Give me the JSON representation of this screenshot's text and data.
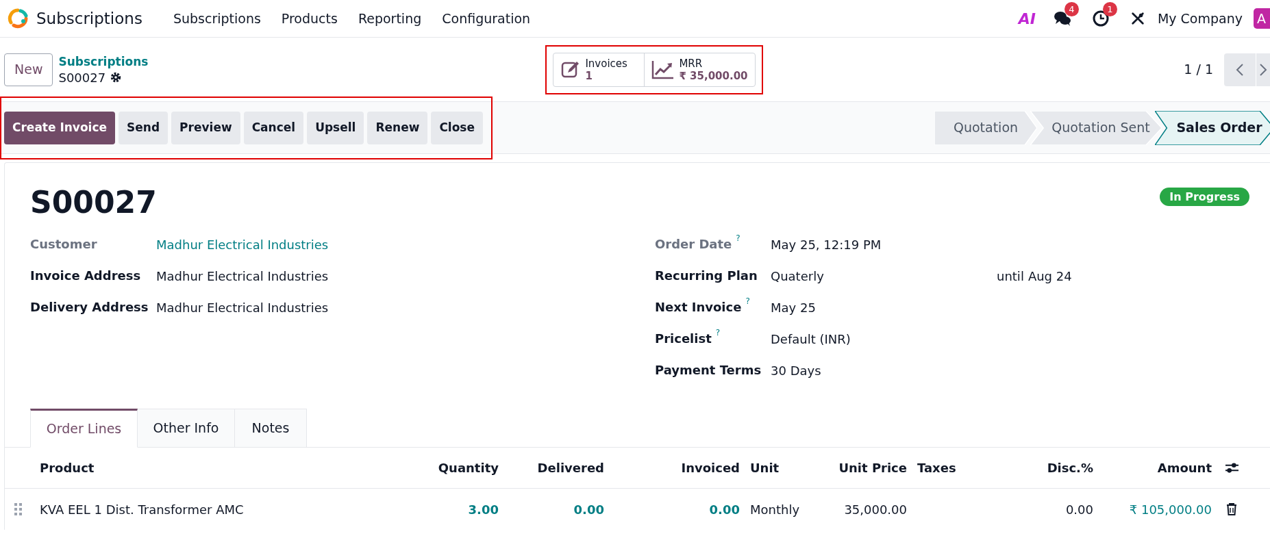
{
  "navbar": {
    "app_name": "Subscriptions",
    "menu": [
      "Subscriptions",
      "Products",
      "Reporting",
      "Configuration"
    ],
    "ai_label": "AI",
    "messages_count": "4",
    "activities_count": "1",
    "company": "My Company",
    "avatar_initial": "A"
  },
  "control_panel": {
    "new_button": "New",
    "breadcrumb": "Subscriptions",
    "record": "S00027",
    "highlighted": true,
    "smart_buttons": [
      {
        "kind": "invoices",
        "label": "Invoices",
        "value": "1"
      },
      {
        "kind": "mrr",
        "label": "MRR",
        "value": "₹ 35,000.00"
      }
    ],
    "pager": "1 / 1"
  },
  "action_bar": {
    "highlighted": true,
    "buttons": [
      {
        "label": "Create Invoice",
        "primary": true
      },
      {
        "label": "Send",
        "primary": false
      },
      {
        "label": "Preview",
        "primary": false
      },
      {
        "label": "Cancel",
        "primary": false
      },
      {
        "label": "Upsell",
        "primary": false
      },
      {
        "label": "Renew",
        "primary": false
      },
      {
        "label": "Close",
        "primary": false
      }
    ],
    "stages": [
      {
        "label": "Quotation",
        "selected": false
      },
      {
        "label": "Quotation Sent",
        "selected": false
      },
      {
        "label": "Sales Order",
        "selected": true
      }
    ]
  },
  "form": {
    "title": "S00027",
    "status_badge": "In Progress",
    "left_fields": [
      {
        "label": "Customer",
        "value": "Madhur Electrical Industries",
        "muted_label": true,
        "link": true,
        "help": false
      },
      {
        "label": "Invoice Address",
        "value": "Madhur Electrical Industries",
        "muted_label": false,
        "link": false,
        "help": false
      },
      {
        "label": "Delivery Address",
        "value": "Madhur Electrical Industries",
        "muted_label": false,
        "link": false,
        "help": false
      }
    ],
    "right_fields": [
      {
        "label": "Order Date",
        "value": "May 25, 12:19 PM",
        "muted_label": true,
        "link": false,
        "help": true
      },
      {
        "label": "Recurring Plan",
        "value": "Quaterly",
        "suffix": "until",
        "suffix_value": "Aug 24",
        "muted_label": false,
        "link": false,
        "help": false
      },
      {
        "label": "Next Invoice",
        "value": "May 25",
        "muted_label": false,
        "link": false,
        "help": true
      },
      {
        "label": "Pricelist",
        "value": "Default (INR)",
        "muted_label": false,
        "link": false,
        "help": true
      },
      {
        "label": "Payment Terms",
        "value": "30 Days",
        "muted_label": false,
        "link": false,
        "help": false
      }
    ],
    "help_mark": "?",
    "tabs": [
      {
        "label": "Order Lines",
        "selected": true
      },
      {
        "label": "Other Info",
        "selected": false
      },
      {
        "label": "Notes",
        "selected": false
      }
    ]
  },
  "table": {
    "columns": [
      {
        "label": "Product",
        "kind": "text"
      },
      {
        "label": "Quantity",
        "kind": "qty"
      },
      {
        "label": "Delivered",
        "kind": "qty"
      },
      {
        "label": "Invoiced",
        "kind": "qty"
      },
      {
        "label": "Unit",
        "kind": "text"
      },
      {
        "label": "Unit Price",
        "kind": "number"
      },
      {
        "label": "Taxes",
        "kind": "text"
      },
      {
        "label": "Disc.%",
        "kind": "number"
      },
      {
        "label": "Amount",
        "kind": "amount"
      }
    ],
    "rows": [
      {
        "cells": [
          "KVA EEL 1 Dist. Transformer AMC",
          "3.00",
          "0.00",
          "0.00",
          "Monthly",
          "35,000.00",
          "",
          "0.00",
          "₹ 105,000.00"
        ]
      }
    ]
  }
}
